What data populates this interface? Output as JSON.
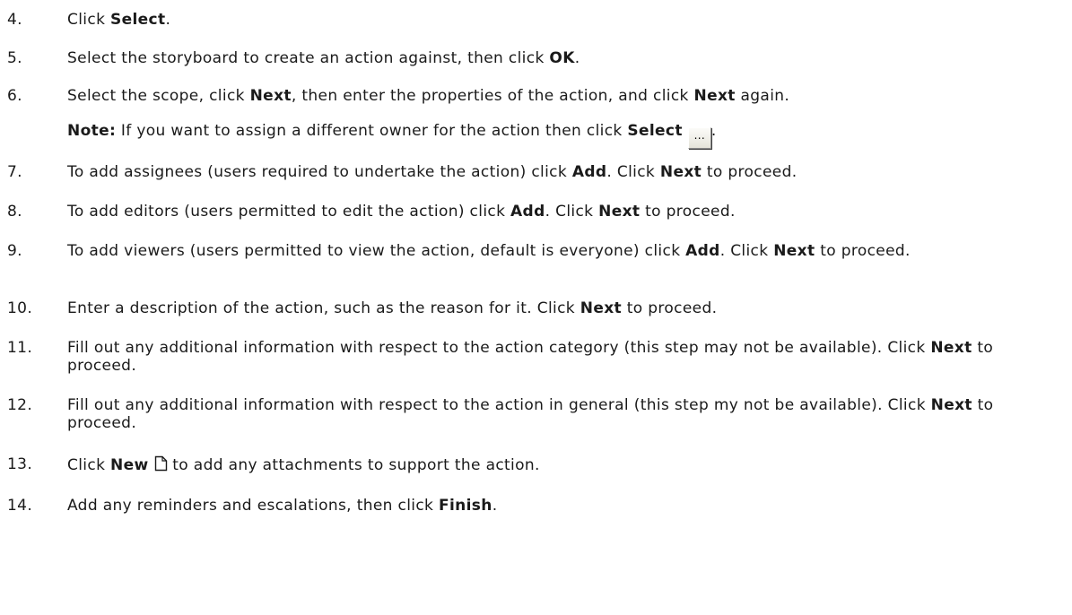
{
  "steps": [
    {
      "num": "4.",
      "pre": "Click ",
      "b1": "Select",
      "post": "."
    },
    {
      "num": "5.",
      "pre": "Select the storyboard to create an action against, then click ",
      "b1": "OK",
      "post": "."
    },
    {
      "num": "6.",
      "pre": "Select the scope, click ",
      "b1": "Next",
      "mid": ", then enter the properties of the action, and click ",
      "b2": "Next",
      "post": " again."
    },
    {
      "num": "7.",
      "pre": "To add assignees (users required to undertake the action) click ",
      "b1": "Add",
      "mid": ". Click ",
      "b2": "Next",
      "post": " to proceed."
    },
    {
      "num": "8.",
      "pre": "To add editors (users permitted to edit the action) click ",
      "b1": "Add",
      "mid": ". Click ",
      "b2": "Next",
      "post": " to proceed."
    },
    {
      "num": "9.",
      "pre": "To add viewers (users permitted to view the action, default is everyone) click ",
      "b1": "Add",
      "mid": ". Click ",
      "b2": "Next",
      "post": " to proceed."
    },
    {
      "num": "10.",
      "pre": "Enter a description of the action, such as the reason for it. Click ",
      "b1": "Next",
      "post": " to proceed."
    },
    {
      "num": "11.",
      "pre": "Fill out any additional information with respect to the action category (this step may not be available). Click ",
      "b1": "Next",
      "post": " to proceed."
    },
    {
      "num": "12.",
      "pre": "Fill out any additional information with respect to the action in general (this step my not be available). Click ",
      "b1": "Next",
      "post": " to proceed."
    },
    {
      "num": "13.",
      "pre": "Click ",
      "b1": "New",
      "post": " to add any attachments to support the action."
    },
    {
      "num": "14.",
      "pre": "Add any reminders and escalations, then click ",
      "b1": "Finish",
      "post": "."
    }
  ],
  "note": {
    "label": "Note:",
    "pre": " If you want to assign a different owner for the action then click ",
    "b1": "Select",
    "button_glyph": "...",
    "post": "."
  },
  "icons": {
    "select_button": "ellipsis-button-icon",
    "new_document": "new-document-icon"
  }
}
